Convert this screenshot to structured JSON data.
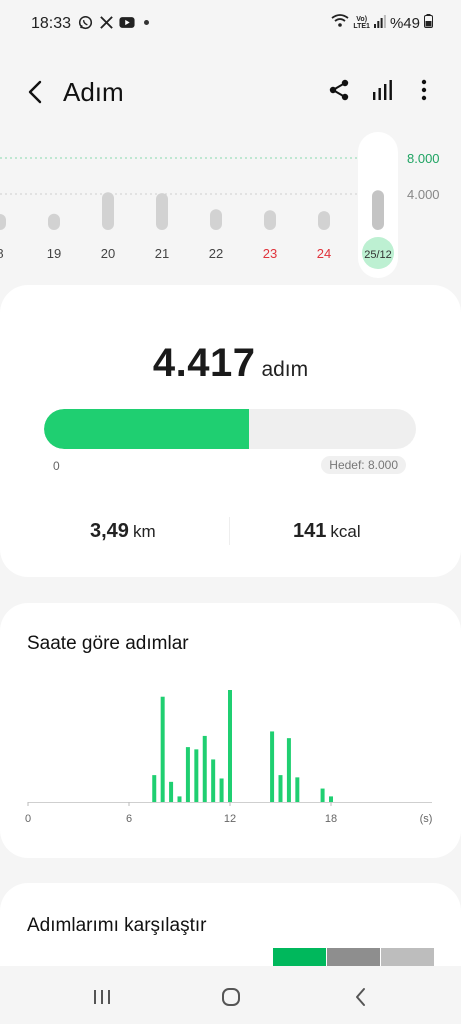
{
  "status_bar": {
    "time": "18:33",
    "left_icons": [
      "whatsapp-icon",
      "x-icon",
      "youtube-icon"
    ],
    "network_label": "LTE1",
    "network_top": "Vo)",
    "battery": "%49"
  },
  "header": {
    "title": "Adım",
    "icons": [
      "back-icon",
      "share-icon",
      "stats-icon",
      "more-icon"
    ]
  },
  "daily_chart": {
    "type": "bar",
    "categories": [
      "8",
      "19",
      "20",
      "21",
      "22",
      "23",
      "24",
      "25/12"
    ],
    "values": [
      1700,
      1800,
      4200,
      4100,
      2300,
      2200,
      2100,
      4417
    ],
    "weekend_indices": [
      5,
      6
    ],
    "selected_index": 7,
    "y_ticks": [
      "8.000",
      "4.000"
    ],
    "goal_value": 8000,
    "ylim": [
      0,
      8000
    ]
  },
  "steps_card": {
    "count": "4.417",
    "unit": "adım",
    "progress": 0.552,
    "min_label": "0",
    "goal_label": "Hedef: 8.000",
    "distance_value": "3,49",
    "distance_unit": "km",
    "calories_value": "141",
    "calories_unit": "kcal"
  },
  "hourly_card": {
    "title": "Saate göre adımlar",
    "chart_data": {
      "type": "bar",
      "xlabel": "(s)",
      "x_ticks": [
        "0",
        "6",
        "12",
        "18"
      ],
      "xlim": [
        0,
        24
      ],
      "bars": [
        {
          "x": 7.5,
          "v": 0.24
        },
        {
          "x": 8.0,
          "v": 0.94
        },
        {
          "x": 8.5,
          "v": 0.18
        },
        {
          "x": 9.0,
          "v": 0.05
        },
        {
          "x": 9.5,
          "v": 0.49
        },
        {
          "x": 10.0,
          "v": 0.47
        },
        {
          "x": 10.5,
          "v": 0.59
        },
        {
          "x": 11.0,
          "v": 0.38
        },
        {
          "x": 11.5,
          "v": 0.21
        },
        {
          "x": 12.0,
          "v": 1.0
        },
        {
          "x": 14.5,
          "v": 0.63
        },
        {
          "x": 15.0,
          "v": 0.24
        },
        {
          "x": 15.5,
          "v": 0.57
        },
        {
          "x": 16.0,
          "v": 0.22
        },
        {
          "x": 17.5,
          "v": 0.12
        },
        {
          "x": 18.0,
          "v": 0.05
        }
      ]
    }
  },
  "compare_card": {
    "title": "Adımlarımı karşılaştır",
    "segments": [
      {
        "color": "#00b85c"
      },
      {
        "color": "#8e8e8e"
      },
      {
        "color": "#bdbdbd"
      }
    ]
  },
  "nav": {
    "icons": [
      "recent-apps-icon",
      "home-icon",
      "back-nav-icon"
    ]
  },
  "colors": {
    "accent": "#1fcf71",
    "bar_gray": "#d2d2d2",
    "weekend_red": "#e0333b",
    "goal_green": "#1fa463"
  }
}
